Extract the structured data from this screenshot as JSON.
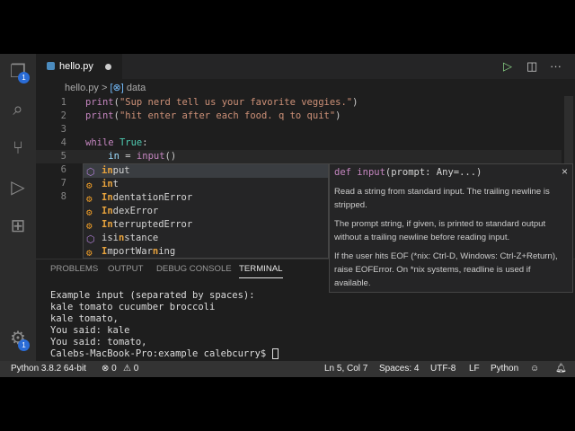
{
  "tab": {
    "filename": "hello.py"
  },
  "breadcrumb": {
    "file": "hello.py",
    "separator": ">",
    "symbol_icon": "[⊗]",
    "symbol": "data"
  },
  "activity": {
    "explorer_badge": "1",
    "settings_badge": "1"
  },
  "code": [
    {
      "n": "1"
    },
    {
      "n": "2"
    },
    {
      "n": "3"
    },
    {
      "n": "4"
    },
    {
      "n": "5"
    },
    {
      "n": "6"
    },
    {
      "n": "7"
    },
    {
      "n": "8"
    }
  ],
  "code_text": {
    "l1a": "print",
    "l1b": "(",
    "l1c": "\"Sup nerd tell us your favorite veggies.\"",
    "l1d": ")",
    "l2a": "print",
    "l2b": "(",
    "l2c": "\"hit enter after each food. q to quit\"",
    "l2d": ")",
    "l4a": "while",
    "l4b": "True",
    "l4c": ":",
    "l5a": "in",
    "l5b": " = ",
    "l5c": "input",
    "l5d": "()"
  },
  "suggestions": [
    {
      "hl": "in",
      "rest": "put"
    },
    {
      "hl": "in",
      "rest": "t"
    },
    {
      "hl": "In",
      "rest": "dentationError"
    },
    {
      "hl": "In",
      "rest": "dexError"
    },
    {
      "hl": "In",
      "rest": "terruptedError"
    },
    {
      "pre": "isi",
      "hl": "n",
      "rest": "stance"
    },
    {
      "hl": "I",
      "mid": "mportWar",
      "hl2": "n",
      "rest": "ing"
    }
  ],
  "hover": {
    "sig_kw": "def",
    "sig_name": "input",
    "sig_args": "(prompt: Any=...)",
    "close": "×",
    "p1": "Read a string from standard input. The trailing newline is stripped.",
    "p2": "The prompt string, if given, is printed to standard output without a trailing newline before reading input.",
    "p3": "If the user hits EOF (*nix: Ctrl-D, Windows: Ctrl-Z+Return), raise EOFError. On *nix systems, readline is used if available."
  },
  "panel": {
    "tabs": [
      "PROBLEMS",
      "OUTPUT",
      "DEBUG CONSOLE",
      "TERMINAL"
    ],
    "terminal": [
      "Example input (separated by spaces):",
      "kale tomato cucumber broccoli",
      "kale tomato,",
      "You said: kale",
      "You said: tomato,",
      "Calebs-MacBook-Pro:example calebcurry$ "
    ]
  },
  "status": {
    "interpreter": "Python 3.8.2 64-bit",
    "errors": "⊗ 0",
    "warnings": "⚠ 0",
    "position": "Ln 5, Col 7",
    "spaces": "Spaces: 4",
    "encoding": "UTF-8",
    "eol": "LF",
    "language": "Python"
  }
}
